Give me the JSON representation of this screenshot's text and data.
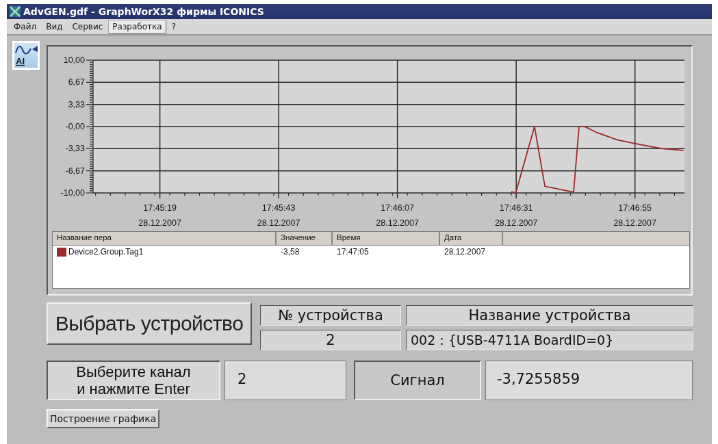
{
  "window": {
    "title": "AdvGEN.gdf - GraphWorX32 фирмы ICONICS"
  },
  "menu": [
    {
      "label": "Файл",
      "selected": false
    },
    {
      "label": "Вид",
      "selected": false
    },
    {
      "label": "Сервис",
      "selected": false
    },
    {
      "label": "Разработка",
      "selected": true
    },
    {
      "label": "?",
      "selected": false
    }
  ],
  "tool_icon": {
    "label": "AI"
  },
  "trend": {
    "chart_data": {
      "type": "line",
      "x": [
        63990.0,
        63990.9,
        63994.7,
        63996.8,
        64002.6,
        64003.7,
        64004.8,
        64007.3,
        64011.4,
        64014.7,
        64020.2,
        64024.8
      ],
      "series": [
        {
          "color": "#9b2a2a",
          "values": [
            -9.8,
            -10,
            0,
            -9.0,
            -9.9,
            0,
            0,
            -0.9,
            -2.0,
            -2.5,
            -3.3,
            -3.6
          ]
        }
      ],
      "grid": true,
      "xlim": [
        63905.5,
        64025
      ],
      "ylim": [
        -10,
        10
      ],
      "xticks": [
        {
          "value": 63919,
          "label": "17:45:19"
        },
        {
          "value": 63943,
          "label": "17:45:43"
        },
        {
          "value": 63967,
          "label": "17:46:07"
        },
        {
          "value": 63991,
          "label": "17:46:31"
        },
        {
          "value": 64015,
          "label": "17:46:55"
        }
      ],
      "yticks": [
        {
          "value": 10,
          "label": "10,00"
        },
        {
          "value": 6.67,
          "label": "6,67"
        },
        {
          "value": 3.33,
          "label": "3,33"
        },
        {
          "value": 0,
          "label": "-0,00"
        },
        {
          "value": -3.33,
          "label": "-3,33"
        },
        {
          "value": -6.67,
          "label": "-6,67"
        },
        {
          "value": -10,
          "label": "-10,00"
        }
      ]
    },
    "x_tick_dates": [
      "28.12.2007",
      "28.12.2007",
      "28.12.2007",
      "28.12.2007",
      "28.12.2007"
    ],
    "legend": {
      "columns": [
        "Название пера",
        "Значение",
        "Время",
        "Дата"
      ],
      "rows": [
        {
          "pen": "Device2.Group.Tag1",
          "color": "#9b2a2a",
          "value": "-3,58",
          "time": "17:47:05",
          "date": "28.12.2007"
        }
      ]
    }
  },
  "device": {
    "select_button": "Выбрать устройство",
    "number_header": "№ устройства",
    "name_header": "Название устройства",
    "number_value": "2",
    "name_value": "002 : {USB-4711A BoardID=0}"
  },
  "channel": {
    "prompt": "Выберите канал и нажмите Enter",
    "value": "2",
    "signal_label": "Сигнал",
    "signal_value": "-3,7255859"
  },
  "plot_button": "Построение графика"
}
